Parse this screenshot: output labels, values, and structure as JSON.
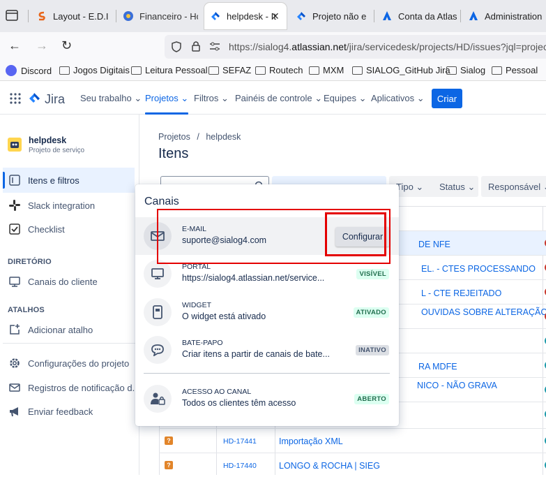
{
  "browser": {
    "tabs": [
      {
        "label": "Layout - E.D.I"
      },
      {
        "label": "Financeiro - Hc"
      },
      {
        "label": "helpdesk - It"
      },
      {
        "label": "Projeto não enc"
      },
      {
        "label": "Conta da Atlass"
      },
      {
        "label": "Administration"
      }
    ],
    "url_prefix": "https://sialog4.",
    "url_domain": "atlassian.net",
    "url_rest": "/jira/servicedesk/projects/HD/issues?jql=project",
    "bookmarks": [
      "Discord",
      "Jogos Digitais",
      "Leitura Pessoal",
      "SEFAZ",
      "Routech",
      "MXM",
      "SIALOG_GitHub Jira",
      "Sialog",
      "Pessoal"
    ]
  },
  "jira_nav": {
    "logo": "Jira",
    "items": [
      "Seu trabalho",
      "Projetos",
      "Filtros",
      "Painéis de controle",
      "Equipes",
      "Aplicativos"
    ],
    "create": "Criar"
  },
  "sidebar": {
    "project_name": "helpdesk",
    "project_type": "Projeto de serviço",
    "items": [
      "Itens e filtros",
      "Slack integration",
      "Checklist"
    ],
    "section_directory": "DIRETÓRIO",
    "directory_items": [
      "Canais do cliente"
    ],
    "section_shortcuts": "ATALHOS",
    "shortcut_items": [
      "Adicionar atalho"
    ],
    "bottom_items": [
      "Configurações do projeto",
      "Registros de notificação d...",
      "Enviar feedback"
    ]
  },
  "main": {
    "breadcrumb_1": "Projetos",
    "breadcrumb_sep": "/",
    "breadcrumb_2": "helpdesk",
    "title": "Itens",
    "filters": [
      "Tipo",
      "Status",
      "Responsável"
    ],
    "rows": [
      {
        "key": "",
        "summary": "DE NFE"
      },
      {
        "key": "",
        "summary": "EL. - CTES PROCESSANDO"
      },
      {
        "key": "",
        "summary": "L - CTE REJEITADO"
      },
      {
        "key": "",
        "summary": "OUVIDAS SOBRE ALTERAÇÃO"
      },
      {
        "key": "",
        "summary": ""
      },
      {
        "key": "",
        "summary": "RA MDFE"
      },
      {
        "key": "",
        "summary": "NICO - NÃO GRAVA"
      },
      {
        "key": "",
        "summary": ""
      },
      {
        "key": "HD-17441",
        "summary": "Importação XML"
      },
      {
        "key": "HD-17440",
        "summary": "LONGO & ROCHA | SIEG"
      }
    ]
  },
  "popup": {
    "title": "Canais",
    "channels": [
      {
        "title": "E-MAIL",
        "sub": "suporte@sialog4.com",
        "action": "Configurar"
      },
      {
        "title": "PORTAL",
        "sub": "https://sialog4.atlassian.net/service...",
        "status": "VISÍVEL"
      },
      {
        "title": "WIDGET",
        "sub": "O widget está ativado",
        "status": "ATIVADO"
      },
      {
        "title": "BATE-PAPO",
        "sub": "Criar itens a partir de canais de bate...",
        "status": "INATIVO"
      },
      {
        "title": "ACESSO AO CANAL",
        "sub": "Todos os clientes têm acesso",
        "status": "ABERTO"
      }
    ]
  },
  "colors": {
    "accent": "#0C66E4",
    "highlight": "#E40000"
  }
}
